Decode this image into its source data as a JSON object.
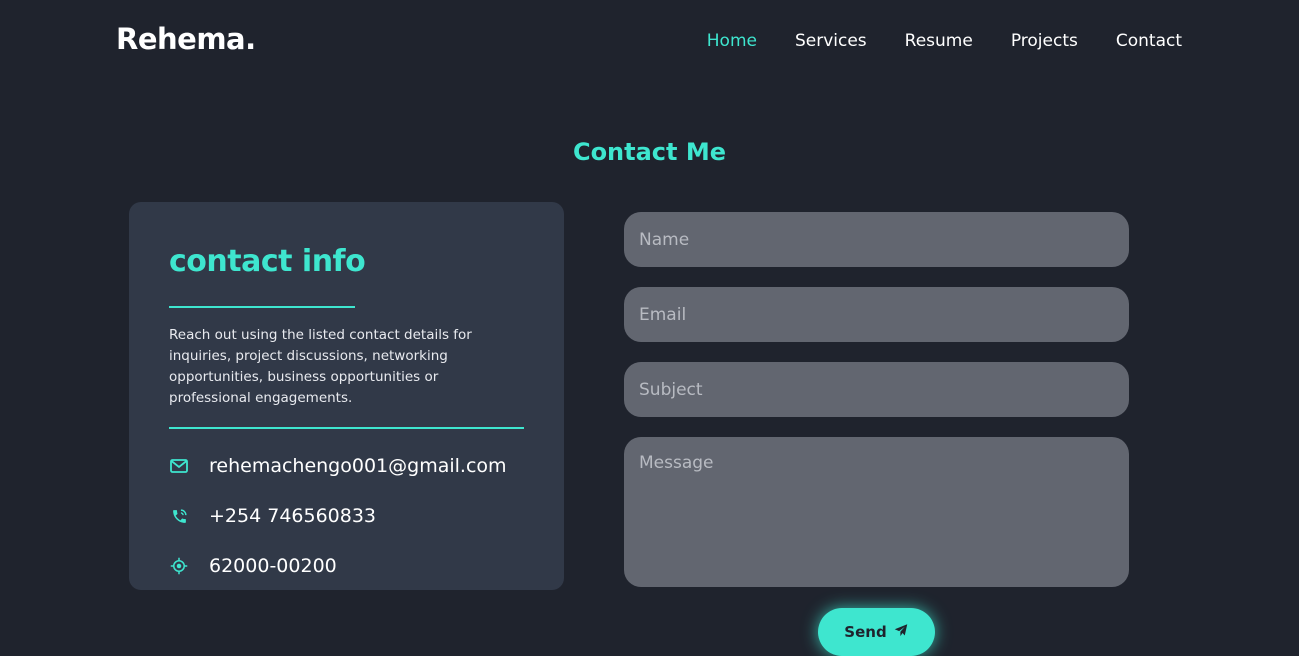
{
  "header": {
    "logo": "Rehema.",
    "nav": [
      {
        "label": "Home",
        "active": true
      },
      {
        "label": "Services",
        "active": false
      },
      {
        "label": "Resume",
        "active": false
      },
      {
        "label": "Projects",
        "active": false
      },
      {
        "label": "Contact",
        "active": false
      }
    ]
  },
  "contact": {
    "section_title": "Contact Me",
    "info": {
      "title": "contact info",
      "description": "Reach out using the listed contact details for inquiries, project discussions, networking opportunities, business opportunities or professional engagements.",
      "email": {
        "icon": "mail-icon",
        "value": "rehemachengo001@gmail.com"
      },
      "phone": {
        "icon": "phone-icon",
        "value": "+254 746560833"
      },
      "location": {
        "icon": "location-icon",
        "value": "62000-00200"
      }
    },
    "form": {
      "name_placeholder": "Name",
      "email_placeholder": "Email",
      "subject_placeholder": "Subject",
      "message_placeholder": "Message",
      "send_label": "Send",
      "send_icon": "paper-plane-icon"
    }
  },
  "colors": {
    "background": "#1f232d",
    "card": "#313948",
    "accent": "#3ee6cf",
    "input": "#626670"
  }
}
